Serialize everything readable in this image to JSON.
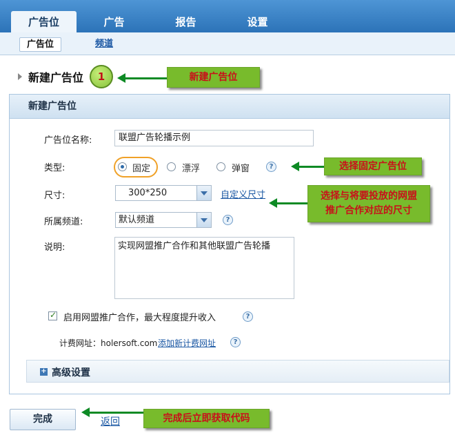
{
  "nav": {
    "tabs": [
      "广告位",
      "广告",
      "报告",
      "设置"
    ],
    "active_tab": "广告位",
    "subtabs": [
      "广告位",
      "频道"
    ]
  },
  "page": {
    "title": "新建广告位",
    "step_number": "1"
  },
  "panel": {
    "title": "新建广告位",
    "name_label": "广告位名称:",
    "name_value": "联盟广告轮播示例",
    "type_label": "类型:",
    "type_options": [
      "固定",
      "漂浮",
      "弹窗"
    ],
    "type_selected": "固定",
    "size_label": "尺寸:",
    "size_value": "300*250",
    "custom_size_link": "自定义尺寸",
    "channel_label": "所属频道:",
    "channel_value": "默认频道",
    "desc_label": "说明:",
    "desc_value": "实现网盟推广合作和其他联盟广告轮播",
    "network_checkbox_label": "启用网盟推广合作，最大程度提升收入",
    "network_checked": true,
    "billing_label": "计费网址：holersoft.com",
    "add_billing_link": "添加新计费网址",
    "advanced_label": "高级设置",
    "help_glyph": "?"
  },
  "footer": {
    "done_button": "完成",
    "back_link": "返回"
  },
  "callouts": {
    "new": "新建广告位",
    "fixed": "选择固定广告位",
    "size_line1": "选择与将要投放的网盟",
    "size_line2": "推广合作对应的尺寸",
    "done": "完成后立即获取代码"
  },
  "colors": {
    "nav": "#2c73b8",
    "callout_bg": "#78bb2c",
    "callout_text": "#c8101a",
    "arrow": "#0d8a24",
    "highlight_oval": "#f0a127"
  }
}
